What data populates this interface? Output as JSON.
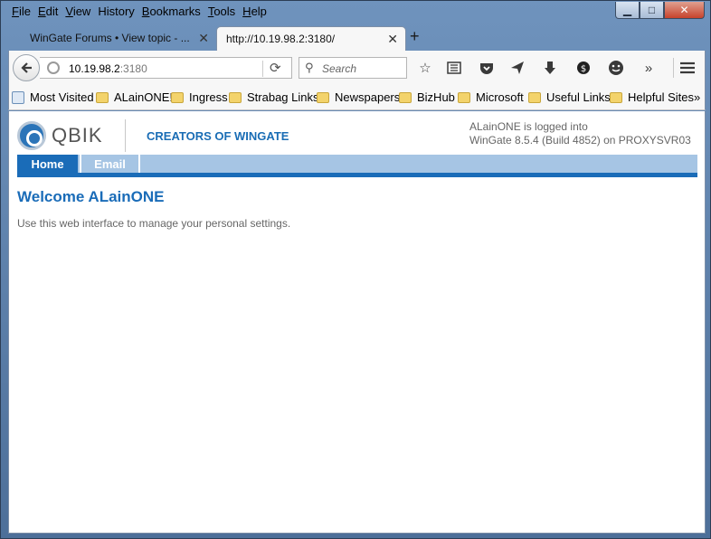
{
  "window": {
    "minimize": "▁",
    "maximize": "□",
    "close": "✕"
  },
  "menu": {
    "items": [
      {
        "first": "F",
        "rest": "ile"
      },
      {
        "first": "E",
        "rest": "dit"
      },
      {
        "first": "V",
        "rest": "iew"
      },
      {
        "first": "H",
        "rest": "istory",
        "pre": ""
      },
      {
        "first": "B",
        "rest": "ookmarks"
      },
      {
        "first": "T",
        "rest": "ools"
      },
      {
        "first": "H",
        "rest": "elp"
      }
    ]
  },
  "tabs": {
    "inactive_title": "WinGate Forums • View topic - ...",
    "active_title": "http://10.19.98.2:3180/",
    "close_glyph": "✕",
    "new_tab_glyph": "+"
  },
  "navbar": {
    "url_host": "10.19.98.2",
    "url_port": ":3180",
    "search_placeholder": "Search"
  },
  "bookmarks": [
    {
      "label": "Most Visited",
      "type": "special"
    },
    {
      "label": "ALainONE!",
      "type": "folder"
    },
    {
      "label": "Ingress",
      "type": "folder"
    },
    {
      "label": "Strabag Links",
      "type": "folder"
    },
    {
      "label": "Newspapers",
      "type": "folder"
    },
    {
      "label": "BizHub",
      "type": "folder"
    },
    {
      "label": "Microsoft",
      "type": "folder"
    },
    {
      "label": "Useful Links",
      "type": "folder"
    },
    {
      "label": "Helpful Sites",
      "type": "folder"
    }
  ],
  "bookmarks_overflow": "»",
  "page": {
    "logo_text": "QBIK",
    "tagline": "CREATORS OF WINGATE",
    "login_line1": "ALainONE is logged into",
    "login_line2": "WinGate 8.5.4 (Build 4852) on PROXYSVR03",
    "nav": {
      "home": "Home",
      "email": "Email"
    },
    "welcome": "Welcome ALainONE",
    "description": "Use this web interface to manage your personal settings."
  }
}
